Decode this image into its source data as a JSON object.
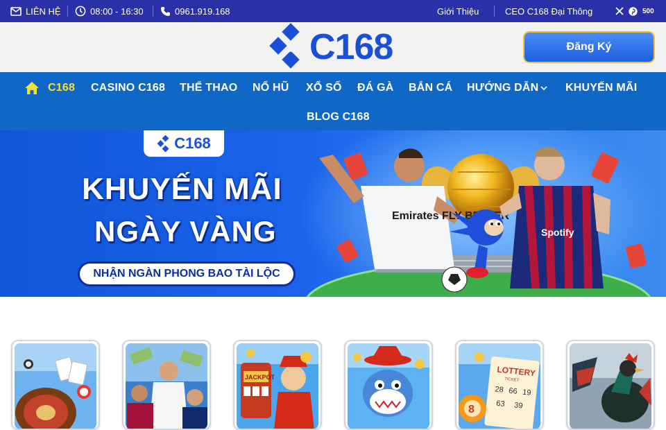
{
  "topbar": {
    "contact_label": "LIÊN HỆ",
    "hours": "08:00 - 16:30",
    "phone": "0961.919.168",
    "about_link": "Giới Thiệu",
    "ceo_link": "CEO C168 Đại Thông",
    "social_icons": [
      "x-icon",
      "pinterest-icon",
      "500px-icon"
    ],
    "social_500": "500"
  },
  "header": {
    "logo_text": "C168",
    "register_button": "Đăng Ký"
  },
  "nav": {
    "home_icon": "home-icon",
    "items": [
      "C168",
      "CASINO C168",
      "THỂ THAO",
      "NỔ HŨ",
      "XỔ SỐ",
      "ĐÁ GÀ",
      "BẮN CÁ",
      "HƯỚNG DẪN",
      "KHUYẾN MÃI",
      "BLOG C168"
    ],
    "active_item": "C168"
  },
  "banner": {
    "logo_text": "C168",
    "title_line1": "KHUYẾN MÃI",
    "title_line2": "NGÀY VÀNG",
    "subtitle": "NHẬN NGÀN PHONG BAO TÀI LỘC",
    "jersey_text_left": "Emirates FLY BETTER",
    "jersey_text_right": "Spotify"
  },
  "game_cards": [
    "casino-card",
    "sports-card",
    "slots-card",
    "fishing-card",
    "lottery-card",
    "cockfight-card"
  ],
  "lottery_card": {
    "ticket_text": "LOTTERY",
    "ticket_sub": "TICKET",
    "numbers": [
      "28",
      "66",
      "19",
      "63",
      "39",
      "8"
    ]
  },
  "colors": {
    "topbar": "#2a30a8",
    "nav": "#1068c6",
    "active_nav": "#f3e033",
    "brand_blue": "#1a4fd8",
    "register_border": "#f0c030"
  }
}
